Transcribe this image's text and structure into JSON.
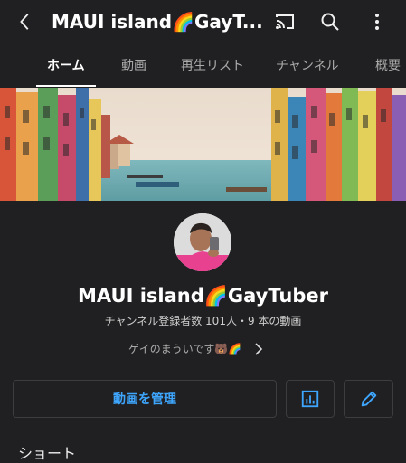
{
  "header": {
    "title": "MAUI island🌈GayT...",
    "icons": {
      "back": "back-arrow-icon",
      "cast": "cast-icon",
      "search": "search-icon",
      "more": "more-vertical-icon"
    }
  },
  "tabs": [
    {
      "label": "ホーム",
      "active": true
    },
    {
      "label": "動画",
      "active": false
    },
    {
      "label": "再生リスト",
      "active": false
    },
    {
      "label": "チャンネル",
      "active": false
    },
    {
      "label": "概要",
      "active": false
    }
  ],
  "channel": {
    "name": "MAUI island🌈GayTuber",
    "stats": "チャンネル登録者数 101人・9 本の動画",
    "description": "ゲイのまういです🐻🌈"
  },
  "actions": {
    "manage_label": "動画を管理",
    "analytics_icon": "analytics-icon",
    "edit_icon": "pencil-icon"
  },
  "sections": {
    "shorts_title": "ショート"
  },
  "colors": {
    "background": "#202022",
    "accent": "#3ea6ff",
    "text": "#f1f1f1",
    "muted": "#aaaaaa"
  }
}
